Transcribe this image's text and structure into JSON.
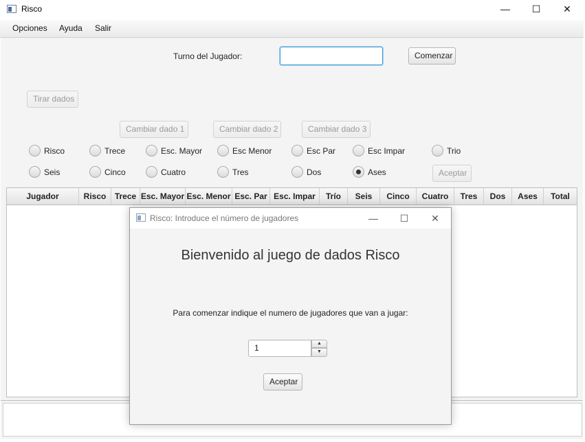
{
  "window": {
    "title": "Risco",
    "controls": {
      "minimize": "—",
      "maximize": "☐",
      "close": "✕"
    }
  },
  "menu": {
    "items": [
      "Opciones",
      "Ayuda",
      "Salir"
    ]
  },
  "turn": {
    "label": "Turno del Jugador:",
    "value": "",
    "start_button": "Comenzar"
  },
  "dice": {
    "roll_button": "Tirar dados",
    "change_buttons": [
      "Cambiar dado 1",
      "Cambiar dado 2",
      "Cambiar dado 3"
    ]
  },
  "options": {
    "row1": [
      "Risco",
      "Trece",
      "Esc. Mayor",
      "Esc Menor",
      "Esc Par",
      "Esc Impar",
      "Trio"
    ],
    "row2": [
      "Seis",
      "Cinco",
      "Cuatro",
      "Tres",
      "Dos",
      "Ases"
    ],
    "selected": "Ases",
    "accept_button": "Aceptar"
  },
  "table": {
    "columns": [
      "Jugador",
      "Risco",
      "Trece",
      "Esc. Mayor",
      "Esc. Menor",
      "Esc.  Par",
      "Esc. Impar",
      "Trío",
      "Seis",
      "Cinco",
      "Cuatro",
      "Tres",
      "Dos",
      "Ases",
      "Total"
    ],
    "rows": []
  },
  "dialog": {
    "title": "Risco: Introduce el número de jugadores",
    "controls": {
      "minimize": "—",
      "maximize": "☐",
      "close": "✕"
    },
    "welcome": "Bienvenido al juego de dados Risco",
    "prompt": "Para comenzar indique el numero de jugadores que van a jugar:",
    "players_value": "1",
    "accept_button": "Aceptar"
  },
  "icons": {
    "spinner_up": "caret-up-icon",
    "spinner_down": "caret-down-icon",
    "app": "window-icon"
  }
}
